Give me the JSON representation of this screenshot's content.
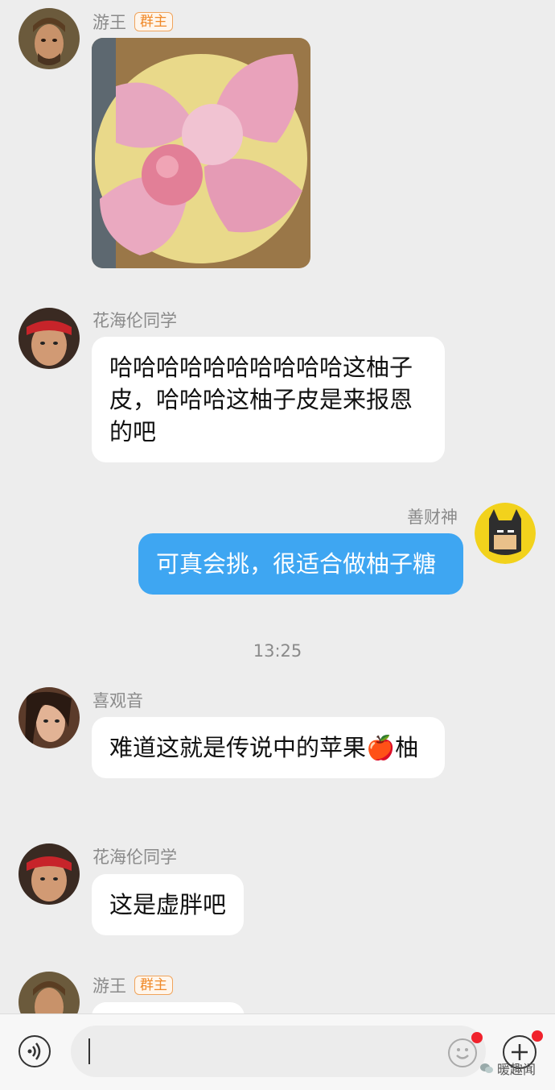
{
  "messages": [
    {
      "sender": "游王",
      "badge": "群主",
      "type": "image",
      "image_desc": "grapefruit peel opened like a flower with an apple in the center"
    },
    {
      "sender": "花海伦同学",
      "text": "哈哈哈哈哈哈哈哈哈哈这柚子皮，哈哈哈这柚子皮是来报恩的吧"
    },
    {
      "sender": "善财神",
      "text": "可真会挑，很适合做柚子糖",
      "self": true
    },
    {
      "sender": "喜观音",
      "text": "难道这就是传说中的苹果🍎柚"
    },
    {
      "sender": "花海伦同学",
      "text": "这是虚胖吧"
    },
    {
      "sender": "游王",
      "badge": "群主"
    }
  ],
  "timestamp": "13:25",
  "colors": {
    "self_bubble": "#3ea6f2",
    "badge": "#f08a2a",
    "background": "#ededed"
  },
  "bottom_bar": {
    "voice_icon": "voice-icon",
    "emoji_icon": "emoji-icon",
    "plus_icon": "plus-icon"
  },
  "watermark": "暖趣闻"
}
